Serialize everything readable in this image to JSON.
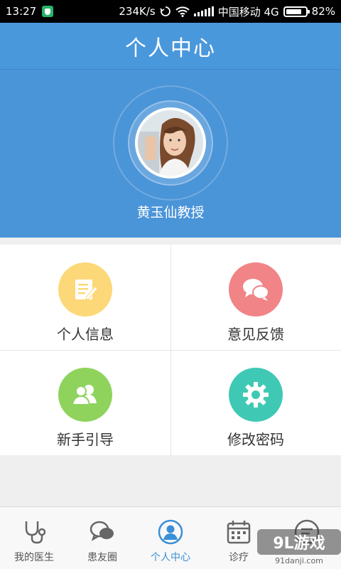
{
  "status_bar": {
    "time": "13:27",
    "speed": "234K/s",
    "carrier": "中国移动 4G",
    "battery": "82%",
    "battery_level": 0.82
  },
  "header": {
    "title": "个人中心"
  },
  "profile": {
    "name": "黄玉仙教授",
    "avatar_icon": "avatar-photo"
  },
  "menu": [
    {
      "label": "个人信息",
      "icon": "document-edit-icon",
      "color": "#fcd879"
    },
    {
      "label": "意见反馈",
      "icon": "chat-bubbles-icon",
      "color": "#f08486"
    },
    {
      "label": "新手引导",
      "icon": "users-icon",
      "color": "#8fd35c"
    },
    {
      "label": "修改密码",
      "icon": "gear-icon",
      "color": "#3fc9b5"
    }
  ],
  "bottom_nav": [
    {
      "label": "我的医生",
      "icon": "stethoscope-icon",
      "active": false
    },
    {
      "label": "患友圈",
      "icon": "chat-icon",
      "active": false
    },
    {
      "label": "个人中心",
      "icon": "user-icon",
      "active": true
    },
    {
      "label": "诊疗",
      "icon": "calendar-icon",
      "active": false
    },
    {
      "label": "",
      "icon": "message-icon",
      "active": false
    }
  ],
  "watermark": {
    "logo": "9L游戏",
    "url": "91danji.com"
  },
  "colors": {
    "primary": "#4a94d8",
    "active_nav": "#3b8fd6"
  }
}
